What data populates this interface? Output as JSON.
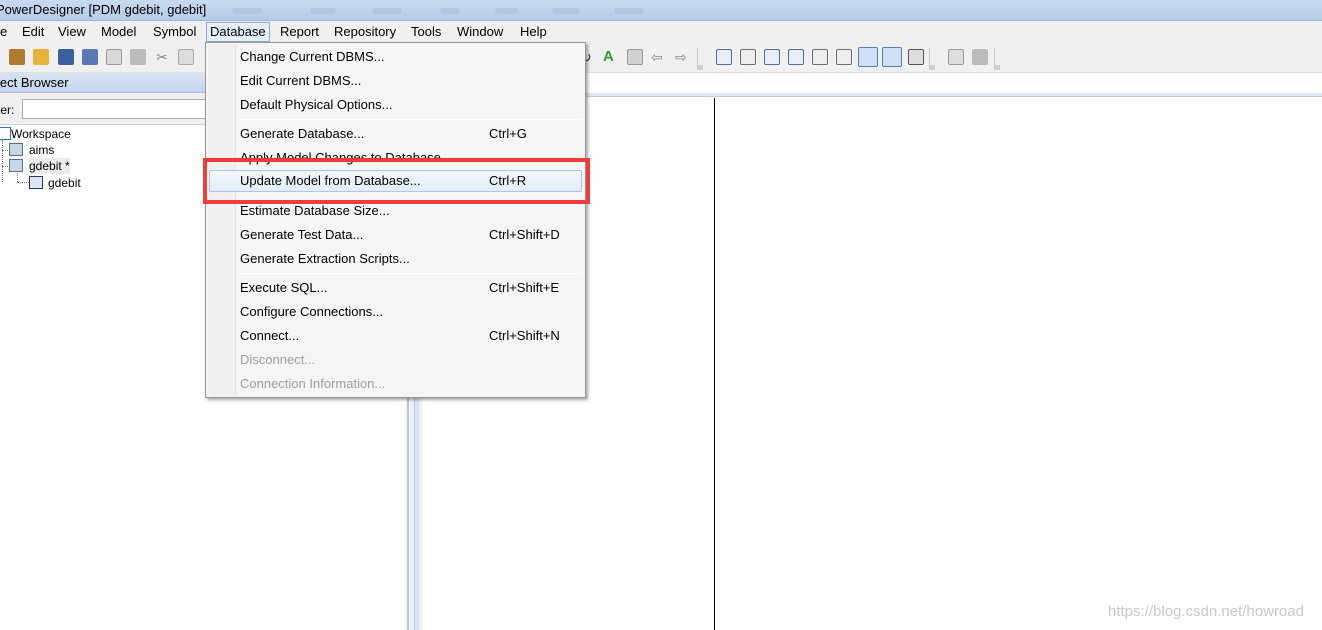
{
  "window": {
    "title": "PowerDesigner [PDM gdebit, gdebit]"
  },
  "menubar": {
    "items": [
      {
        "label": "e"
      },
      {
        "label": "Edit"
      },
      {
        "label": "View"
      },
      {
        "label": "Model"
      },
      {
        "label": "Symbol"
      },
      {
        "label": "Database"
      },
      {
        "label": "Report"
      },
      {
        "label": "Repository"
      },
      {
        "label": "Tools"
      },
      {
        "label": "Window"
      },
      {
        "label": "Help"
      }
    ],
    "active": "Database"
  },
  "browser": {
    "header": "ject Browser",
    "filter_label": "ter:",
    "filter_value": "",
    "tree": [
      {
        "label": "Workspace",
        "icon": "workspace-icon"
      },
      {
        "label": "aims",
        "icon": "model-icon"
      },
      {
        "label": "gdebit *",
        "icon": "model-icon"
      },
      {
        "label": "gdebit",
        "icon": "diagram-icon"
      }
    ]
  },
  "database_menu": {
    "items": [
      {
        "label": "Change Current DBMS...",
        "shortcut": "",
        "enabled": true
      },
      {
        "label": "Edit Current DBMS...",
        "shortcut": "",
        "enabled": true
      },
      {
        "label": "Default Physical Options...",
        "shortcut": "",
        "enabled": true
      },
      {
        "label": "Generate Database...",
        "shortcut": "Ctrl+G",
        "enabled": true
      },
      {
        "label": "Apply Model Changes to Database...",
        "shortcut": "",
        "enabled": true
      },
      {
        "label": "Update Model from Database...",
        "shortcut": "Ctrl+R",
        "enabled": true,
        "highlighted": true
      },
      {
        "label": "Estimate Database Size...",
        "shortcut": "",
        "enabled": true
      },
      {
        "label": "Generate Test Data...",
        "shortcut": "Ctrl+Shift+D",
        "enabled": true
      },
      {
        "label": "Generate Extraction Scripts...",
        "shortcut": "",
        "enabled": true
      },
      {
        "label": "Execute SQL...",
        "shortcut": "Ctrl+Shift+E",
        "enabled": true
      },
      {
        "label": "Configure Connections...",
        "shortcut": "",
        "enabled": true
      },
      {
        "label": "Connect...",
        "shortcut": "Ctrl+Shift+N",
        "enabled": true
      },
      {
        "label": "Disconnect...",
        "shortcut": "",
        "enabled": false
      },
      {
        "label": "Connection Information...",
        "shortcut": "",
        "enabled": false
      }
    ]
  },
  "annotation": {
    "color": "#ef3c3c"
  },
  "watermark": "https://blog.csdn.net/howroad"
}
